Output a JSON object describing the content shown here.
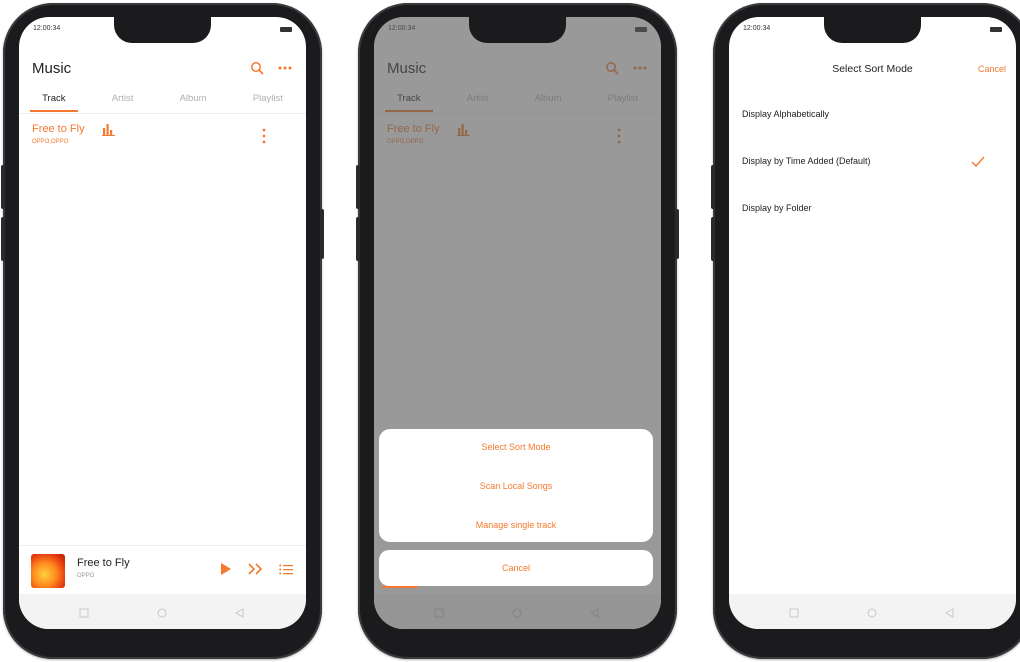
{
  "colors": {
    "accent": "#f4792f",
    "frame": "#1b1b1d",
    "overlay": "rgba(90,90,90,0.62)"
  },
  "status": {
    "time": "12:00:34"
  },
  "music": {
    "title": "Music",
    "tabs": [
      "Track",
      "Artist",
      "Album",
      "Playlist"
    ],
    "track": {
      "title": "Free to Fly",
      "artist": "OPPO,OPPO"
    },
    "player": {
      "title": "Free to Fly",
      "artist": "OPPO"
    }
  },
  "menu": {
    "items": [
      "Select Sort Mode",
      "Scan Local Songs",
      "Manage single track"
    ],
    "cancel": "Cancel"
  },
  "sort": {
    "title": "Select Sort Mode",
    "cancel": "Cancel",
    "options": [
      "Display Alphabetically",
      "Display by Time Added (Default)",
      "Display by Folder"
    ],
    "selected_index": 1
  },
  "icons": [
    "search-icon",
    "more-icon",
    "equalizer-icon",
    "kebab-icon",
    "play-icon",
    "next-icon",
    "playlist-icon",
    "checkmark-icon",
    "nav-back-icon",
    "nav-home-icon",
    "nav-recents-icon"
  ]
}
